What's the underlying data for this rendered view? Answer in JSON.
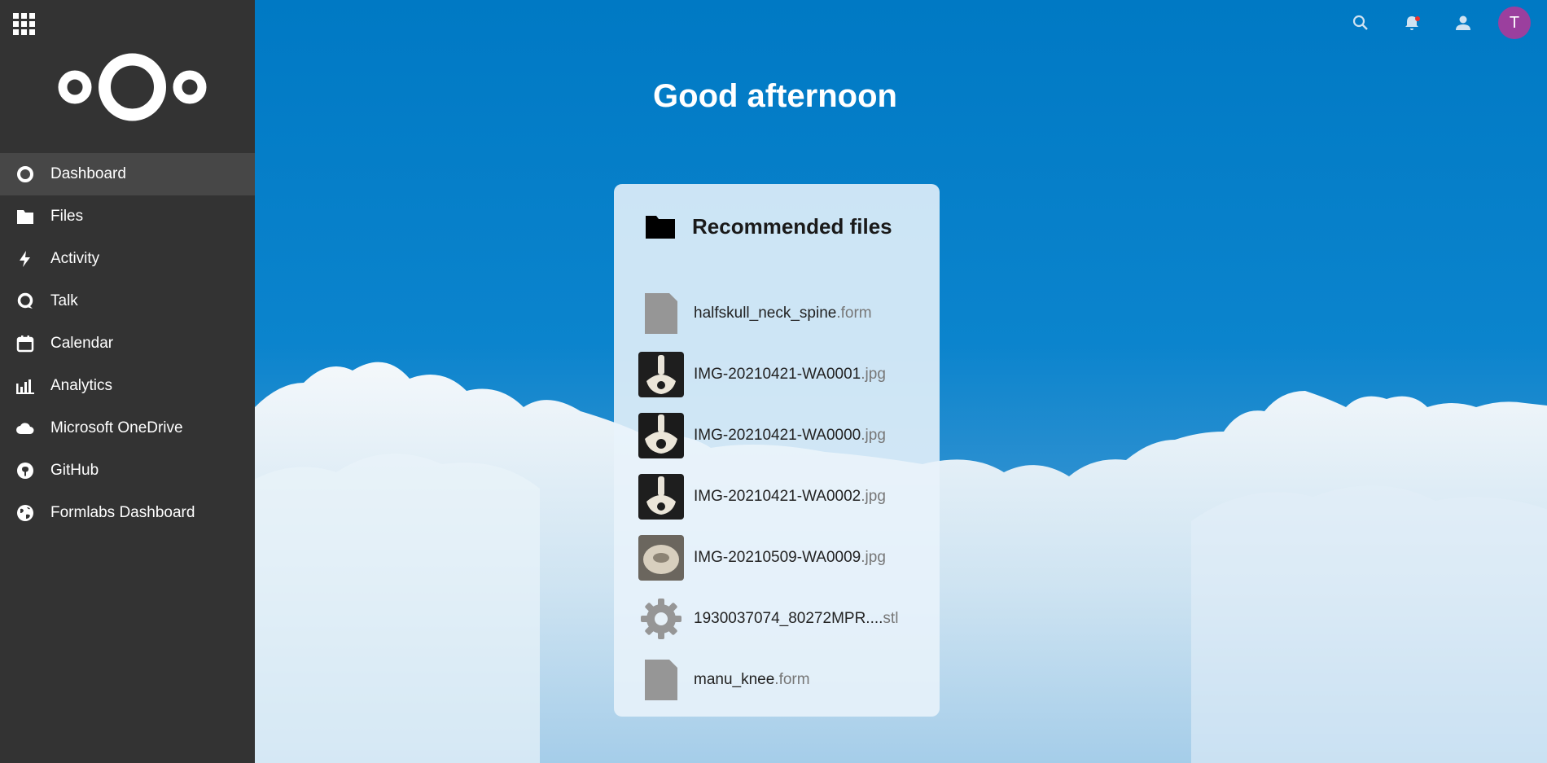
{
  "sidebar": {
    "items": [
      {
        "label": "Dashboard",
        "icon": "dashboard-icon",
        "active": true
      },
      {
        "label": "Files",
        "icon": "folder-icon"
      },
      {
        "label": "Activity",
        "icon": "lightning-icon"
      },
      {
        "label": "Talk",
        "icon": "talk-icon"
      },
      {
        "label": "Calendar",
        "icon": "calendar-icon"
      },
      {
        "label": "Analytics",
        "icon": "bar-chart-icon"
      },
      {
        "label": "Microsoft OneDrive",
        "icon": "cloud-icon"
      },
      {
        "label": "GitHub",
        "icon": "github-icon"
      },
      {
        "label": "Formlabs Dashboard",
        "icon": "globe-icon"
      }
    ]
  },
  "header": {
    "avatar_initial": "T"
  },
  "main": {
    "greeting": "Good afternoon"
  },
  "widget": {
    "title": "Recommended files",
    "files": [
      {
        "name": "halfskull_neck_spine",
        "ext": ".form",
        "thumb": "file-icon"
      },
      {
        "name": "IMG-20210421-WA0001",
        "ext": ".jpg",
        "thumb": "spine-image"
      },
      {
        "name": "IMG-20210421-WA0000",
        "ext": ".jpg",
        "thumb": "spine-image"
      },
      {
        "name": "IMG-20210421-WA0002",
        "ext": ".jpg",
        "thumb": "spine-image"
      },
      {
        "name": "IMG-20210509-WA0009",
        "ext": ".jpg",
        "thumb": "skull-image"
      },
      {
        "name": "1930037074_80272MPR....",
        "ext": "stl",
        "thumb": "gear-icon"
      },
      {
        "name": "manu_knee",
        "ext": ".form",
        "thumb": "file-icon"
      }
    ]
  },
  "colors": {
    "sidebar_bg": "#333333",
    "active_item_bg": "#474747",
    "primary_blue": "#0082c9",
    "avatar_bg": "#9b3f9e"
  }
}
